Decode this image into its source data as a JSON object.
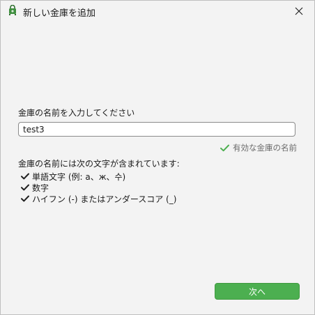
{
  "window": {
    "title": "新しい金庫を追加"
  },
  "form": {
    "prompt_label": "金庫の名前を入力してください",
    "name_value": "test3",
    "name_placeholder": "",
    "valid_status": "有効な金庫の名前"
  },
  "rules": {
    "heading": "金庫の名前には次の文字が含まれています:",
    "items": [
      "単語文字 (例: a、ж、수)",
      "数字",
      "ハイフン (-) またはアンダースコア (_)"
    ]
  },
  "footer": {
    "next_label": "次へ"
  },
  "icons": {
    "app": "vault-app-icon",
    "close": "close-icon",
    "check": "checkmark-icon"
  },
  "colors": {
    "accent_green": "#4caf50",
    "valid_check_green": "#4caf50",
    "check_dark": "#1f1f1f"
  }
}
